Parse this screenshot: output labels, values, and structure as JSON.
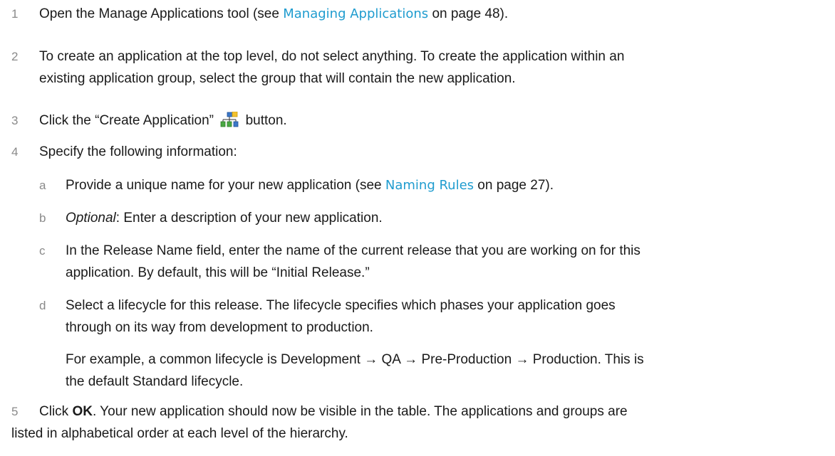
{
  "steps": [
    {
      "number": "1",
      "text_before": "Open the Manage Applications tool (see ",
      "link": "Managing Applications",
      "text_after": " on page 48)."
    },
    {
      "number": "2",
      "line1": "To create an application at the top level, do not select anything. To create the application within an",
      "line2": "existing application group, select the group that will contain the new application."
    },
    {
      "number": "3",
      "text_before": "Click the “Create Application”",
      "icon": "create-application-icon",
      "text_after": "button."
    },
    {
      "number": "4",
      "text": "Specify the following information:",
      "substeps": [
        {
          "letter": "a",
          "text_before": "Provide a unique name for your new application (see ",
          "link": "Naming Rules",
          "text_after": " on page 27)."
        },
        {
          "letter": "b",
          "italic": "Optional",
          "text_after": ": Enter a description of your new application."
        },
        {
          "letter": "c",
          "line1": "In the Release Name field, enter the name of the current release that you are working on for this",
          "line2": "application. By default, this will be “Initial Release.”"
        },
        {
          "letter": "d",
          "line1": "Select a lifecycle for this release. The lifecycle specifies which phases your application goes",
          "line2": "through on its way from development to production.",
          "example_line1": "For example, a common lifecycle is Development → QA → Pre-Production → Production. This is",
          "example_line2": "the default Standard lifecycle."
        }
      ]
    },
    {
      "number": "5",
      "text_before": "Click ",
      "bold": "OK",
      "text_after": ". Your new application should now be visible in the table. The applications and groups are",
      "line2": "listed in alphabetical order at each level of the hierarchy."
    }
  ],
  "colors": {
    "link": "#1f9ccf",
    "number": "#8a8a8a",
    "text": "#1a1a1a"
  }
}
